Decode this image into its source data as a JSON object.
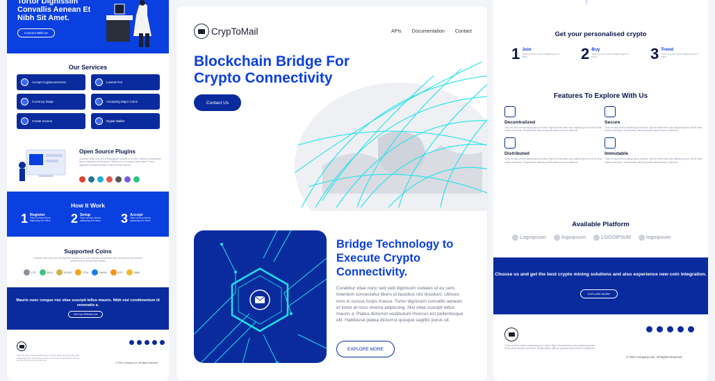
{
  "left": {
    "hero": {
      "title": "Tortor Dignissim Convallis Aenean Et Nibh Sit Amet.",
      "button": "Connect With Us"
    },
    "services": {
      "title": "Our Services",
      "items": [
        "Accept Cryptocurrencies",
        "Lowest Fee",
        "Currency Swap",
        "Accepting Major Coins",
        "Create Invoice",
        "Digital Wallet"
      ]
    },
    "plugins": {
      "title": "Open Source Plugins",
      "desc": "Curabitur vitae nunc sed velit dignissim sodales ut eu sem. Interdum consectetur libero id faucibus nisl tincidunt. Ultrices eros in cursus turpis massa. Tortor dignissim convallis aenean et tortor at risus viverra."
    },
    "how": {
      "title": "How It Work",
      "steps": [
        {
          "n": "1",
          "title": "Register",
          "desc": "Tortor at risus viverra adipiscing at in tellus."
        },
        {
          "n": "2",
          "title": "Setup",
          "desc": "Tortor at risus viverra adipiscing at in tellus."
        },
        {
          "n": "3",
          "title": "Accept",
          "desc": "Tortor at risus viverra adipiscing at in tellus."
        }
      ]
    },
    "coins": {
      "title": "Supported Coins",
      "desc": "Curabitur vitae nunc sed velit dignissim sodales ut eu sem. Interdum consectetur libero id faucibus nisl tincidunt. Ultrices eros in cursus turpis massa.",
      "items": [
        {
          "label": "LTC",
          "color": "#8a8f9c"
        },
        {
          "label": "BCH",
          "color": "#3cc47c"
        },
        {
          "label": "DOGE",
          "color": "#d8b541"
        },
        {
          "label": "TCN",
          "color": "#f7a21b"
        },
        {
          "label": "DASH",
          "color": "#1f7fe5"
        },
        {
          "label": "BTC",
          "color": "#f7931a"
        },
        {
          "label": "BNB",
          "color": "#f3ba2f"
        }
      ]
    },
    "cta": {
      "title": "Mauris nunc congue nisi vitae suscipit tellus mauris. Nibh nisl condimentum id venenatis a.",
      "button": "Get Your Referral Link"
    },
    "footer": {
      "desc": "Tortor at risus viverra adipiscing at in tellus. Eget sit amet tellus cras adipiscing enim. Mi sit amet mauris commodo. Suspendisse ultrices gravida dictum fusce ut placerat.",
      "copyright": "© 2022 Company.com. All Rights Reserved."
    }
  },
  "mid": {
    "nav": {
      "brand": "CrypToMail",
      "links": [
        "APIs",
        "Documentation",
        "Contact"
      ]
    },
    "hero": {
      "title": "Blockchain Bridge For Crypto Connectivity",
      "button": "Contact Us"
    },
    "bridge": {
      "title": "Bridge Technology to Execute Crypto Connectivity.",
      "desc": "Curabitur vitae nunc sed velit dignissim sodales ut eu sem. Interdum consectetur libero id faucibus nisl tincidunt. Ultrices eros in cursus turpis massa. Tortor dignissim convallis aenean et tortor at risus viverra adipiscing. Nisl vitae suscipit tellus mauris a. Platea dictumst vestibulum rhoncus est pellentesque elit. Habitasse platea dictumst quisque sagittis purus sit.",
      "button": "EXPLORE MORE"
    }
  },
  "right": {
    "personal": {
      "title": "Get your personalised crypto",
      "steps": [
        {
          "n": "1",
          "title": "Join",
          "desc": "Tortor at risus viverra adipiscing at in tellus."
        },
        {
          "n": "2",
          "title": "Buy",
          "desc": "Tortor at risus viverra adipiscing at in tellus."
        },
        {
          "n": "3",
          "title": "Trend",
          "desc": "Tortor at risus viverra adipiscing at in tellus."
        }
      ]
    },
    "features": {
      "title": "Features To Explore With Us",
      "items": [
        {
          "title": "Decentralized",
          "desc": "Tortor at risus viverra adipiscing at in tellus. Eget sit amet tellus cras adipiscing enim. Mi sit amet mauris commodo. Suspendisse ultrices gravida dictum fusce ut placerat."
        },
        {
          "title": "Secure",
          "desc": "Tortor at risus viverra adipiscing at in tellus. Eget sit amet tellus cras adipiscing enim. Mi sit amet mauris commodo. Suspendisse ultrices gravida dictum fusce ut placerat."
        },
        {
          "title": "Distributed",
          "desc": "Tortor at risus viverra adipiscing at in tellus. Eget sit amet tellus cras adipiscing enim. Mi sit amet mauris commodo. Suspendisse ultrices gravida dictum fusce ut placerat."
        },
        {
          "title": "Immutable",
          "desc": "Tortor at risus viverra adipiscing at in tellus. Eget sit amet tellus cras adipiscing enim. Mi sit amet mauris commodo. Suspendisse ultrices gravida dictum fusce ut placerat."
        }
      ]
    },
    "platform": {
      "title": "Available Platform",
      "logos": [
        "Logoipsum",
        "logoipsum",
        "LOGOIPSUM",
        "logoipsum"
      ]
    },
    "cta": {
      "title": "Choose us and get the best crypto mining solutions and also experience new coin integration.",
      "button": "EXPLORE MORE"
    },
    "footer": {
      "desc": "Tortor at risus viverra adipiscing at in tellus. Eget sit amet tellus cras adipiscing enim. Mi sit amet mauris commodo. Suspendisse ultrices gravida dictum fusce ut placerat.",
      "copyright": "© 2022 Company.com. All Rights Reserved."
    }
  },
  "colors": {
    "brand_blue": "#0a3fe0",
    "navy": "#0a2b9e",
    "accent_cyan": "#1ee3e8"
  }
}
